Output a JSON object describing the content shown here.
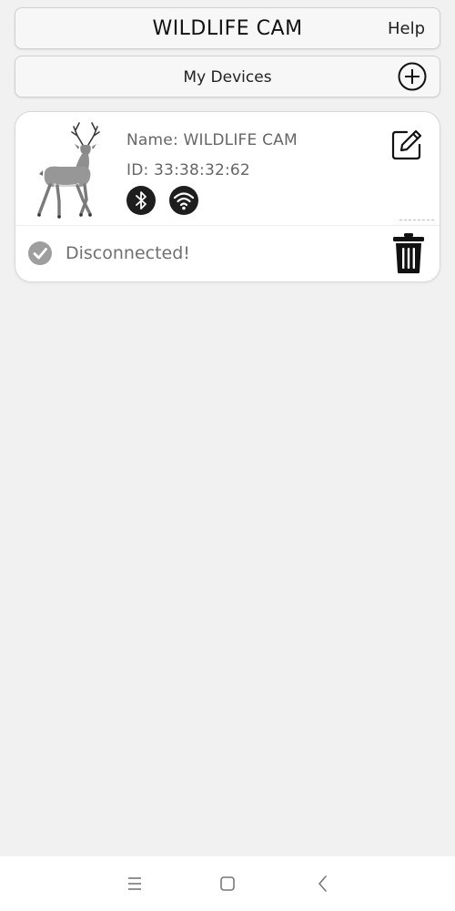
{
  "header": {
    "title": "WILDLIFE CAM",
    "help_label": "Help"
  },
  "devices_bar": {
    "title": "My Devices",
    "add_icon": "plus-circle-icon"
  },
  "device": {
    "name": "Name: WILDLIFE CAM",
    "id": "ID: 33:38:32:62",
    "image": "deer-image",
    "connection_icons": [
      "bluetooth-icon",
      "wifi-icon"
    ],
    "status": "Disconnected!",
    "status_icon": "check-circle-icon",
    "edit_icon": "edit-icon",
    "delete_icon": "trash-icon"
  },
  "nav": {
    "icons": [
      "menu-icon",
      "home-icon",
      "back-icon"
    ]
  },
  "colors": {
    "background": "#f1f1f1",
    "card": "#ffffff",
    "icon_dark": "#1e1e1e",
    "status_gray": "#9e9e9e"
  }
}
